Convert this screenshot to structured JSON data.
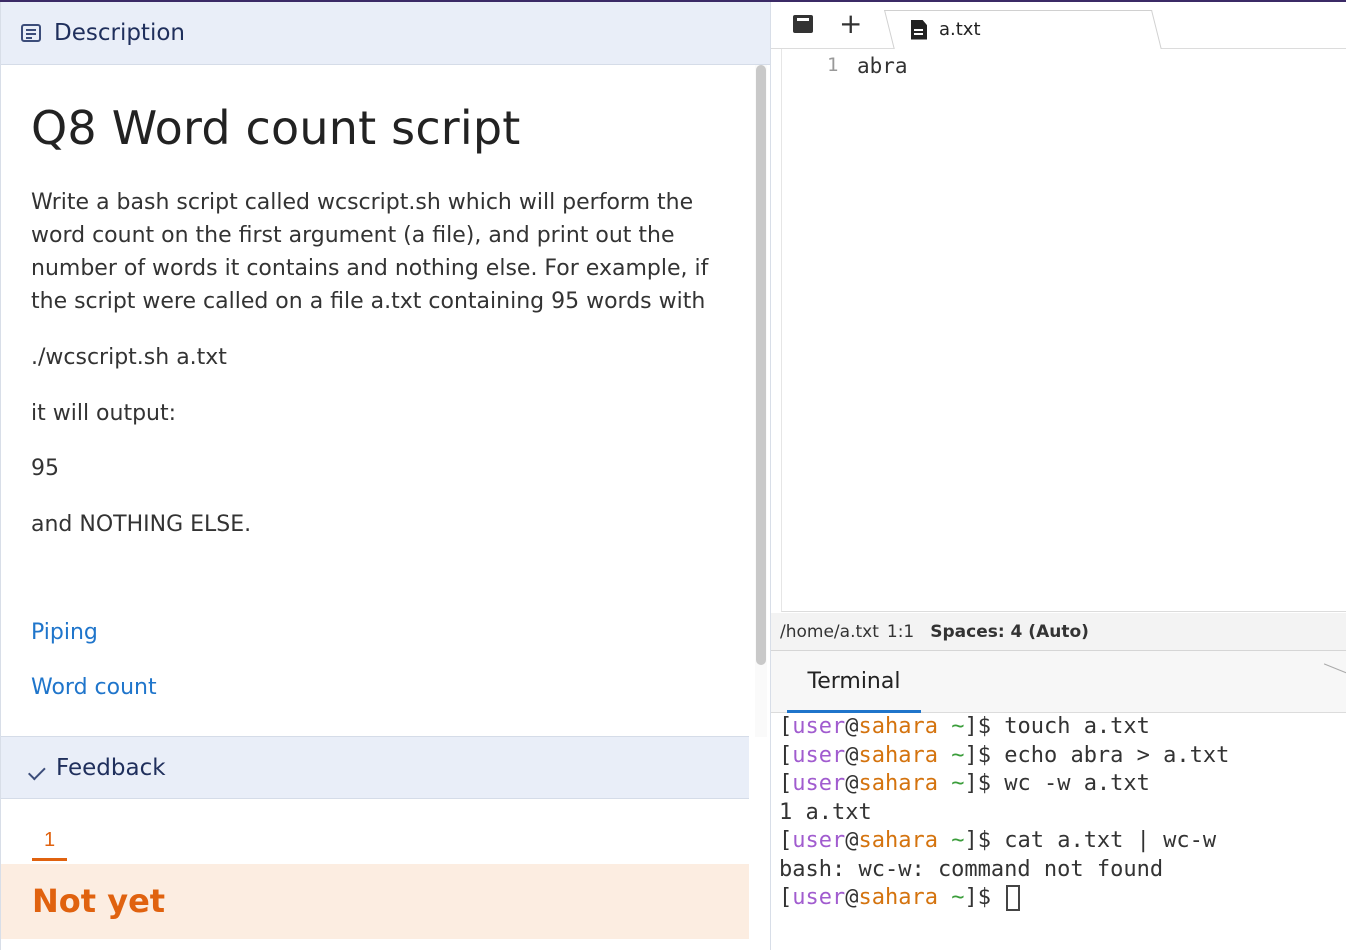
{
  "description": {
    "header_label": "Description",
    "title": "Q8 Word count script",
    "paragraphs": [
      "Write a bash script called wcscript.sh which will perform the word count on the first argument (a file), and print out the number of words it contains and nothing else. For example, if the script were called on a file a.txt containing 95 words with",
      "./wcscript.sh a.txt",
      "it will output:",
      "95",
      "and NOTHING ELSE."
    ],
    "links": [
      "Piping",
      "Word count"
    ]
  },
  "feedback": {
    "header_label": "Feedback",
    "tab_label": "1",
    "status": "Not yet"
  },
  "editor": {
    "tab_label": "a.txt",
    "lines": [
      {
        "number": "1",
        "text": "abra"
      }
    ],
    "status_path": "/home/a.txt",
    "status_position": "1:1",
    "status_spaces": "Spaces: 4 (Auto)"
  },
  "terminal": {
    "tab_label": "Terminal",
    "prompt": {
      "user": "user",
      "at": "@",
      "host": "sahara",
      "tilde": "~",
      "open": "[",
      "close": "]$ "
    },
    "lines": [
      {
        "type": "cmd",
        "text": "touch a.txt"
      },
      {
        "type": "cmd",
        "text": "echo abra > a.txt"
      },
      {
        "type": "cmd",
        "text": "wc -w a.txt"
      },
      {
        "type": "out",
        "text": "1 a.txt"
      },
      {
        "type": "cmd",
        "text": "cat a.txt | wc-w"
      },
      {
        "type": "out",
        "text": "bash: wc-w: command not found"
      },
      {
        "type": "cmd",
        "text": ""
      }
    ]
  },
  "colors": {
    "accent": "#1f75cb",
    "warning": "#e0620f",
    "user": "#a15ccf",
    "host": "#d4730e",
    "tilde": "#3a9d3a"
  }
}
